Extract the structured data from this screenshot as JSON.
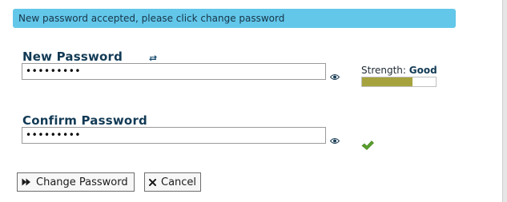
{
  "banner": {
    "message": "New password accepted, please click change password",
    "color": "#63c7ea"
  },
  "new_password": {
    "label": "New Password",
    "value": "•••••••••",
    "refresh_icon": "refresh-icon",
    "toggle_icon": "eye-icon"
  },
  "strength": {
    "label": "Strength:",
    "value": "Good",
    "level_fraction": 0.68,
    "bar_color": "#a6a33e"
  },
  "confirm_password": {
    "label": "Confirm Password",
    "value": "•••••••••",
    "toggle_icon": "eye-icon",
    "match_icon": "checkmark-icon",
    "match_color": "#5aa02c"
  },
  "actions": {
    "change_label": "Change Password",
    "change_icon": "fast-forward-icon",
    "cancel_label": "Cancel",
    "cancel_icon": "x-icon"
  }
}
